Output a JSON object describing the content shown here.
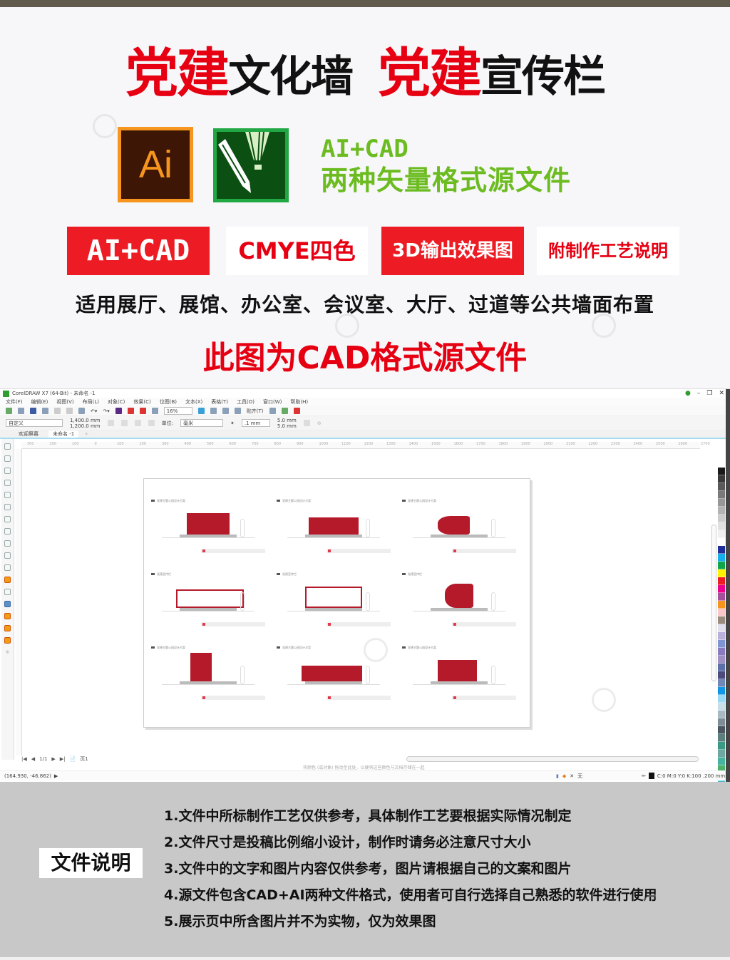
{
  "header": {
    "title_parts": [
      {
        "text": "党建",
        "color": "red"
      },
      {
        "text": "文化墙",
        "color": "black"
      },
      {
        "text": "党建",
        "color": "red"
      },
      {
        "text": "宣传栏",
        "color": "black"
      }
    ],
    "title_red_1": "党建",
    "title_black_1": "文化墙",
    "title_red_2": "党建",
    "title_black_2": "宣传栏"
  },
  "icons": {
    "ai_label": "Ai",
    "ai_icon": "adobe-illustrator-icon",
    "cdr_icon": "coreldraw-icon"
  },
  "formats": {
    "line1": "AI+CAD",
    "line2": "两种矢量格式源文件"
  },
  "badges": [
    {
      "label": "AI+CAD",
      "style": "red"
    },
    {
      "label": "CMYE四色",
      "style": "white"
    },
    {
      "label": "3D输出效果图",
      "style": "red"
    },
    {
      "label": "附制作工艺说明",
      "style": "white"
    }
  ],
  "usage": "适用展厅、展馆、办公室、会议室、大厅、过道等公共墙面布置",
  "note_cad": "此图为CAD格式源文件",
  "app": {
    "title": "CorelDRAW X7 (64-Bit) - 未命名 -1",
    "window_controls": [
      "minimize",
      "restore",
      "close"
    ],
    "menu": [
      "文件(F)",
      "编辑(E)",
      "视图(V)",
      "布局(L)",
      "对象(C)",
      "效果(C)",
      "位图(B)",
      "文本(X)",
      "表格(T)",
      "工具(O)",
      "窗口(W)",
      "帮助(H)"
    ],
    "toolbar": {
      "zoom": "16%",
      "snap": "贴齐(T)"
    },
    "propbar": {
      "preset": "自定义",
      "width": "1,400.0 mm",
      "height": "1,200.0 mm",
      "units_label": "单位:",
      "units": "毫米",
      "nudge": ".1 mm",
      "dup_x": "5.0 mm",
      "dup_y": "5.0 mm"
    },
    "tabs": [
      "欢迎屏幕",
      "未命名 -1"
    ],
    "ruler_ticks": [
      "300",
      "200",
      "100",
      "0",
      "100",
      "200",
      "300",
      "400",
      "500",
      "600",
      "700",
      "800",
      "900",
      "1000",
      "1100",
      "1200",
      "1300",
      "1400",
      "1500",
      "1600",
      "1700",
      "1800",
      "1900",
      "2000",
      "2100",
      "2200",
      "2300",
      "2400",
      "2500",
      "2600",
      "2700"
    ],
    "panels": [
      {
        "caption": "党建主题公园设计方案"
      },
      {
        "caption": "党建主题公园设计方案"
      },
      {
        "caption": "党建主题公园设计方案"
      },
      {
        "caption": "党建宣传栏"
      },
      {
        "caption": "党建宣传栏"
      },
      {
        "caption": "党建宣传栏"
      },
      {
        "caption": "党建主题公园设计方案"
      },
      {
        "caption": "党建主题公园设计方案"
      },
      {
        "caption": "党建主题公园设计方案"
      }
    ],
    "page_nav": {
      "current": "1/1",
      "page_tab": "页1"
    },
    "hint": "将颜色 (或对象) 拖动至此处，以便将这些颜色与文档存储在一起",
    "status": {
      "coords": "(164.930, -46.862)",
      "fill_none": "无",
      "outline": "C:0 M:0 Y:0 K:100  .200 mm"
    },
    "palette": [
      "#1a1a1a",
      "#3a3a3a",
      "#595959",
      "#7a7a7a",
      "#979797",
      "#b3b3b3",
      "#cccccc",
      "#e0e0e0",
      "#f0f0f0",
      "#ffffff",
      "#1f2e99",
      "#14aeea",
      "#0fa64a",
      "#fff200",
      "#ed1c24",
      "#ec008c",
      "#a3519c",
      "#f7941d",
      "#f9c6cb",
      "#9b8b7e",
      "#e2def0",
      "#b9b1dc",
      "#7f95d3",
      "#8a7bc0",
      "#9f8fc4",
      "#5c6fa8",
      "#4d4a7e",
      "#6f88b5",
      "#0f97e5",
      "#9bd8f4",
      "#c8dee9",
      "#a9b9c2",
      "#7f8d96",
      "#4c5861",
      "#5a7f7c",
      "#3a9a86",
      "#6fa8a0",
      "#48b49f",
      "#4fb06a",
      "#45c6e0",
      "#49b6cc",
      "#c5dcc8",
      "#e5f2e3",
      "#b4e0b2",
      "#9fb3a5"
    ]
  },
  "footer": {
    "heading": "文件说明",
    "notes": [
      "1.文件中所标制作工艺仅供参考，具体制作工艺要根据实际情况制定",
      "2.文件尺寸是投稿比例缩小设计，制作时请务必注意尺寸大小",
      "3.文件中的文字和图片内容仅供参考，图片请根据自己的文案和图片",
      "4.源文件包含CAD+AI两种文件格式，使用者可自行选择自己熟悉的软件进行使用",
      "5.展示页中所含图片并不为实物，仅为效果图"
    ]
  },
  "colors": {
    "brand_red": "#e60012",
    "format_green": "#6cbc21",
    "ai_orange": "#f7961e",
    "ai_bg": "#3d1606",
    "cdr_green": "#21a744",
    "footer_bg": "#c8c8c8"
  }
}
